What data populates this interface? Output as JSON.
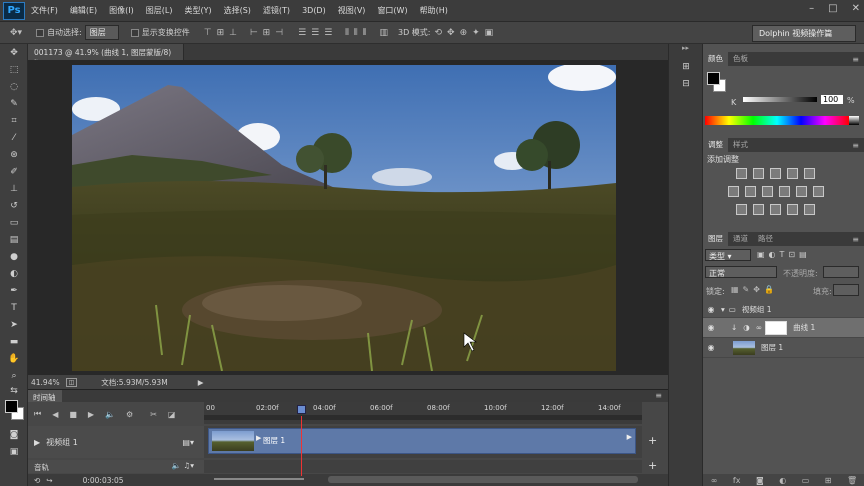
{
  "app": {
    "logo": "Ps"
  },
  "menu": [
    "文件(F)",
    "编辑(E)",
    "图像(I)",
    "图层(L)",
    "类型(Y)",
    "选择(S)",
    "滤镜(T)",
    "3D(D)",
    "视图(V)",
    "窗口(W)",
    "帮助(H)"
  ],
  "options": {
    "auto_select_label": "自动选择:",
    "auto_select_value": "图层",
    "show_transform_label": "显示变换控件",
    "mode_3d_label": "3D 模式:",
    "workspace": "Dolphin 视频操作篇"
  },
  "document": {
    "tab_title": "001173 @ 41.9% (曲线 1, 图层蒙版/8) *",
    "zoom": "41.94%",
    "doc_size": "文档:5.93M/5.93M"
  },
  "timeline": {
    "tab_label": "时间轴",
    "ruler_labels": [
      "00",
      "02:00f",
      "04:00f",
      "06:00f",
      "08:00f",
      "10:00f",
      "12:00f",
      "14:00f"
    ],
    "track_name": "视频组 1",
    "clip_label": "图层 1",
    "audio_label": "音轨",
    "timecode": "0:00:03:05"
  },
  "color_panel": {
    "tabs": [
      "颜色",
      "色板"
    ],
    "k_label": "K",
    "k_value": "100",
    "percent": "%"
  },
  "adjustments_panel": {
    "tabs": [
      "调整",
      "样式"
    ],
    "add_label": "添加调整"
  },
  "layers_panel": {
    "tabs": [
      "图层",
      "通道",
      "路径"
    ],
    "filter_value": "类型",
    "blend_mode": "正常",
    "opacity_label": "不透明度:",
    "lock_label": "锁定:",
    "fill_label": "填充:",
    "layers": [
      {
        "name": "视频组 1"
      },
      {
        "name": "曲线 1"
      },
      {
        "name": "图层 1"
      }
    ]
  },
  "colors": {
    "accent_clip": "#5e79a8",
    "playhead": "#ee3333"
  }
}
